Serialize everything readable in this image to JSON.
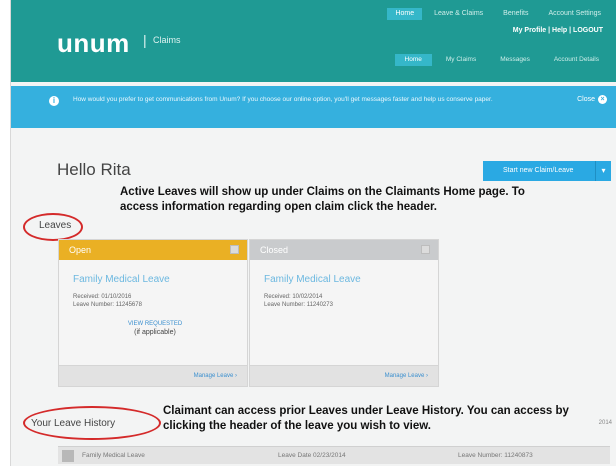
{
  "header": {
    "logo": "unum",
    "logo_sub": "Claims",
    "top_nav": [
      "Home",
      "Leave & Claims",
      "Benefits",
      "Account Settings"
    ],
    "profile_links": "My Profile | Help | LOGOUT",
    "sub_nav": [
      "Home",
      "My Claims",
      "Messages",
      "Account Details"
    ]
  },
  "notice": {
    "text": "How would you prefer to get communications from Unum? If you choose our online option, you'll get messages faster and help us conserve paper.",
    "close_label": "Close"
  },
  "greeting": "Hello Rita",
  "start_button": "Start new Claim/Leave",
  "annotations": {
    "leaves": "Active Leaves will show up under Claims on the Claimants Home page.  To access information regarding open claim click the header.",
    "history": "Claimant can access prior Leaves under Leave History.  You can access by clicking the header of the leave you wish to view."
  },
  "leaves_section_label": "Leaves",
  "cards": [
    {
      "status": "Open",
      "title": "Family Medical Leave",
      "received": "Received: 01/10/2016",
      "leave_number": "Leave Number: 11245678",
      "link": "VIEW REQUESTED",
      "note": "(if applicable)",
      "footer_link": "Manage Leave"
    },
    {
      "status": "Closed",
      "title": "Family Medical Leave",
      "received": "Received: 10/02/2014",
      "leave_number": "Leave Number: 11240273",
      "footer_link": "Manage Leave"
    }
  ],
  "history_section_label": "Your Leave History",
  "side_tag": "2014",
  "history_rows": [
    {
      "type": "Family Medical Leave",
      "date": "Leave Date 02/23/2014",
      "number": "Leave Number: 11240873"
    }
  ],
  "colors": {
    "header": "#1f9a94",
    "notice": "#35b0de",
    "open_status": "#eab024",
    "closed_status": "#c9cbcd",
    "annotation_ring": "#d42a2a"
  }
}
